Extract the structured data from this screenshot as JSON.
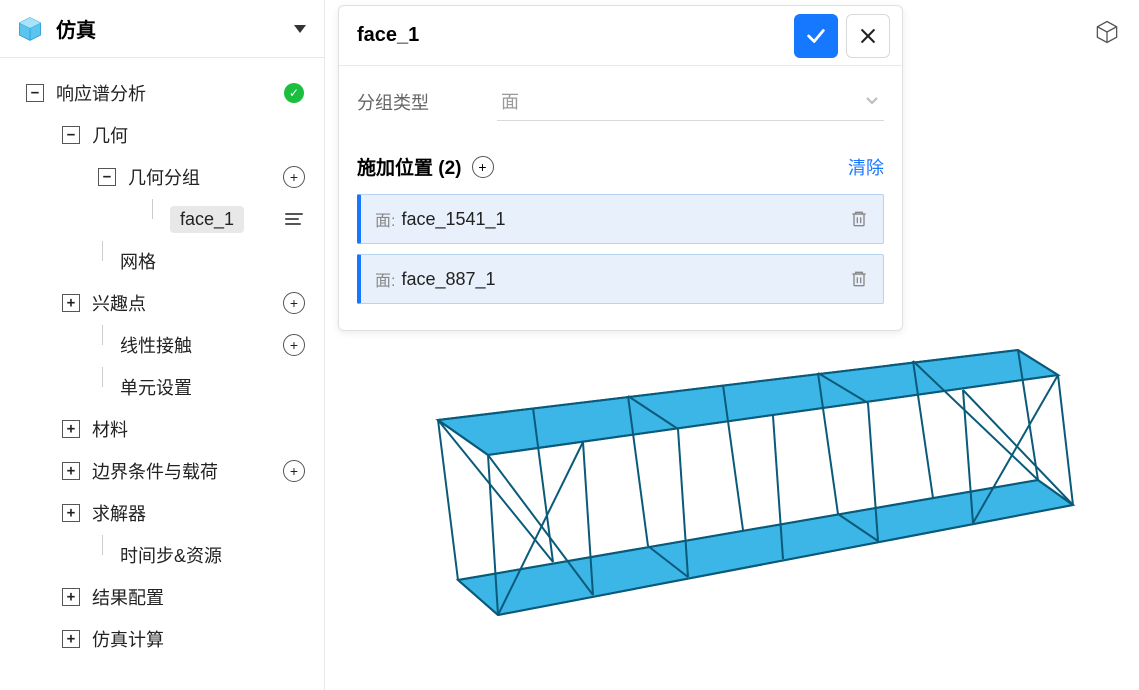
{
  "sidebar": {
    "title": "仿真",
    "root": {
      "label": "响应谱分析"
    },
    "geometry": {
      "label": "几何"
    },
    "geometryGroup": {
      "label": "几何分组"
    },
    "selectedFace": {
      "label": "face_1"
    },
    "mesh": {
      "label": "网格"
    },
    "interestPoints": {
      "label": "兴趣点"
    },
    "linearContact": {
      "label": "线性接触"
    },
    "elementSettings": {
      "label": "单元设置"
    },
    "materials": {
      "label": "材料"
    },
    "boundaryLoads": {
      "label": "边界条件与载荷"
    },
    "solver": {
      "label": "求解器"
    },
    "timestepResources": {
      "label": "时间步&资源"
    },
    "resultConfig": {
      "label": "结果配置"
    },
    "simulationCompute": {
      "label": "仿真计算"
    }
  },
  "panel": {
    "title": "face_1",
    "groupTypeLabel": "分组类型",
    "groupTypeValue": "面",
    "positionSection": "施加位置 (2)",
    "clearLabel": "清除",
    "items": [
      {
        "prefix": "面:",
        "name": "face_1541_1"
      },
      {
        "prefix": "面:",
        "name": "face_887_1"
      }
    ]
  }
}
